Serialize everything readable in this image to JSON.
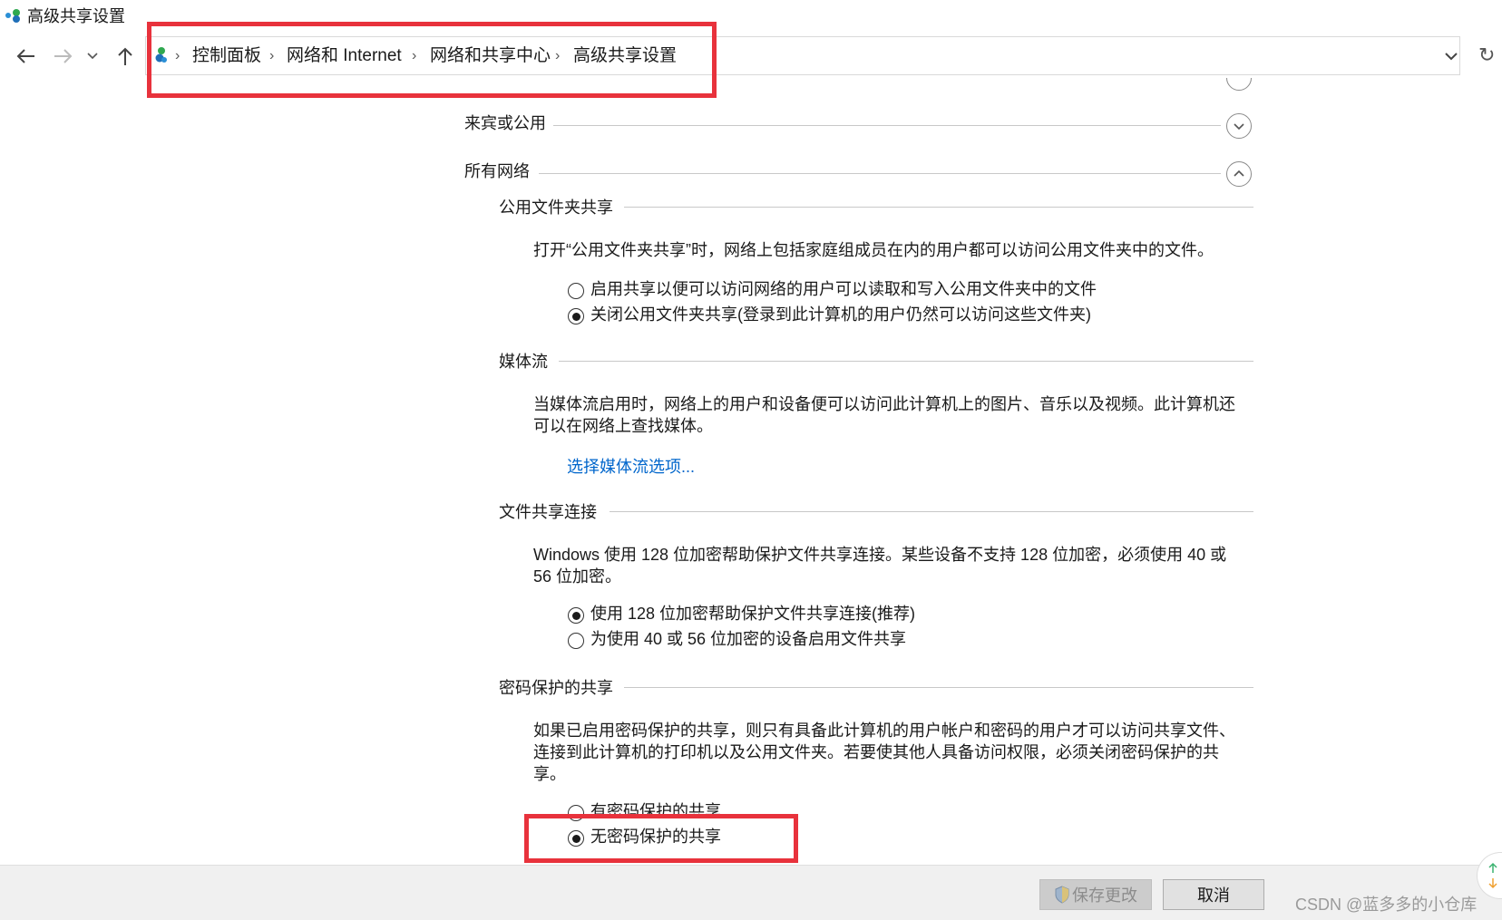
{
  "window": {
    "title": "高级共享设置"
  },
  "nav": {
    "back_icon": "arrow-left-icon",
    "forward_icon": "arrow-right-icon",
    "recent_icon": "chevron-down-icon",
    "up_icon": "arrow-up-icon",
    "breadcrumbs": [
      "控制面板",
      "网络和 Internet",
      "网络和共享中心",
      "高级共享设置"
    ],
    "separator": "›",
    "refresh_glyph": "↻"
  },
  "profiles": [
    {
      "label": "来宾或公用",
      "expanded": false
    },
    {
      "label": "所有网络",
      "expanded": true
    }
  ],
  "sections": {
    "public_folder": {
      "title": "公用文件夹共享",
      "description": "打开“公用文件夹共享”时，网络上包括家庭组成员在内的用户都可以访问公用文件夹中的文件。",
      "options": [
        {
          "label": "启用共享以便可以访问网络的用户可以读取和写入公用文件夹中的文件",
          "selected": false
        },
        {
          "label": "关闭公用文件夹共享(登录到此计算机的用户仍然可以访问这些文件夹)",
          "selected": true
        }
      ]
    },
    "media": {
      "title": "媒体流",
      "description_line1": "当媒体流启用时，网络上的用户和设备便可以访问此计算机上的图片、音乐以及视频。此计算机还",
      "description_line2": "可以在网络上查找媒体。",
      "link": "选择媒体流选项..."
    },
    "file_sharing": {
      "title": "文件共享连接",
      "description_line1": "Windows 使用 128 位加密帮助保护文件共享连接。某些设备不支持 128 位加密，必须使用 40 或",
      "description_line2": "56 位加密。",
      "options": [
        {
          "label": "使用 128 位加密帮助保护文件共享连接(推荐)",
          "selected": true
        },
        {
          "label": "为使用 40 或 56 位加密的设备启用文件共享",
          "selected": false
        }
      ]
    },
    "password": {
      "title": "密码保护的共享",
      "description_line1": "如果已启用密码保护的共享，则只有具备此计算机的用户帐户和密码的用户才可以访问共享文件、",
      "description_line2": "连接到此计算机的打印机以及公用文件夹。若要使其他人具备访问权限，必须关闭密码保护的共",
      "description_line3": "享。",
      "options": [
        {
          "label": "有密码保护的共享",
          "selected": false
        },
        {
          "label": "无密码保护的共享",
          "selected": true
        }
      ]
    }
  },
  "footer": {
    "save_label": "保存更改",
    "cancel_label": "取消",
    "shield_icon": "uac-shield-icon"
  },
  "watermark": "CSDN @蓝多多的小仓库",
  "colors": {
    "highlight": "#e8323c",
    "link": "#0066cc"
  }
}
